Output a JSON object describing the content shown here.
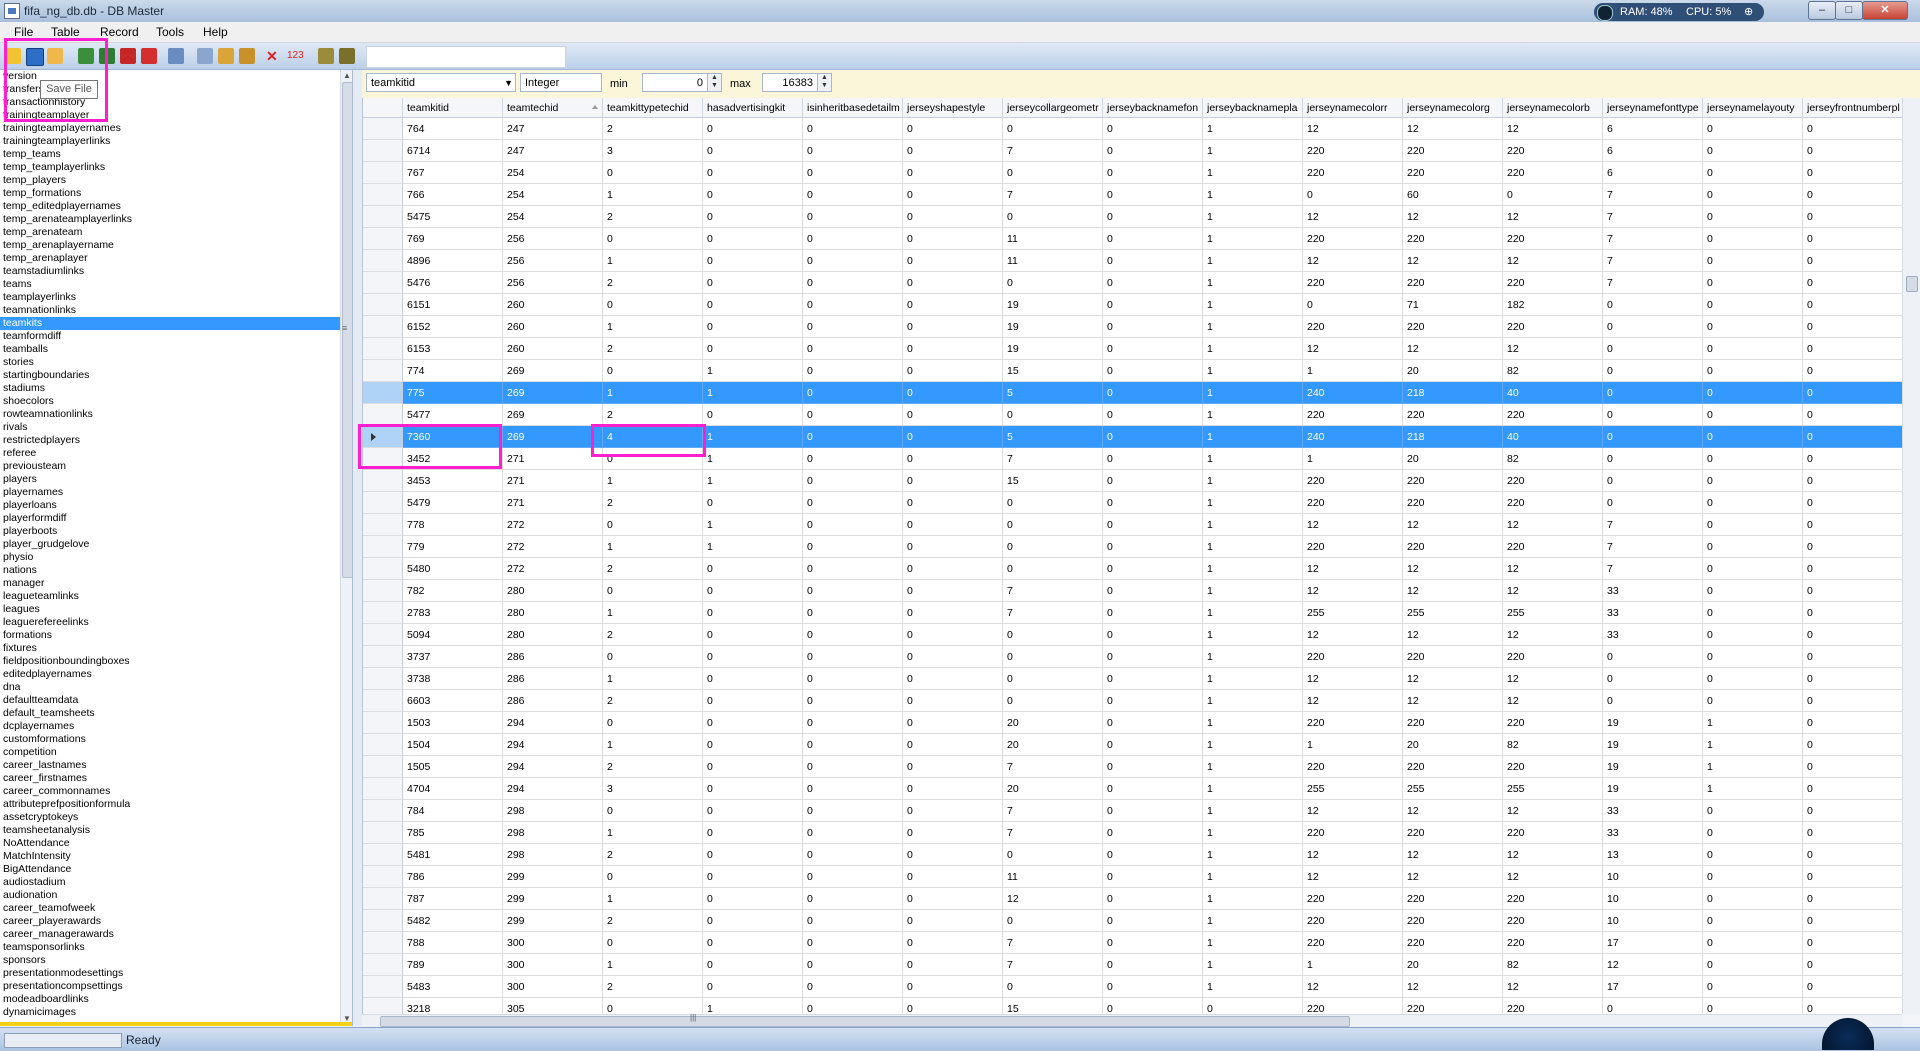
{
  "window": {
    "title": "fifa_ng_db.db - DB Master",
    "ram": "RAM: 48%",
    "cpu": "CPU: 5%",
    "controls": {
      "minimize": "–",
      "maximize": "□",
      "close": "✕"
    }
  },
  "menu": [
    "File",
    "Table",
    "Record",
    "Tools",
    "Help"
  ],
  "toolbar": {
    "buttons": [
      "open-icon",
      "save-icon",
      "folder-icon",
      "import-icon",
      "export-icon",
      "delete-table-icon",
      "export-red-icon",
      "compare-icon",
      "copy-icon",
      "paste-icon",
      "paste-special-icon",
      "delete-icon",
      "numbers-icon",
      "find-icon",
      "replace-icon"
    ],
    "tooltip": "Save File",
    "search_value": ""
  },
  "tables": [
    "version",
    "transfers",
    "transactionhistory",
    "trainingteamplayer",
    "trainingteamplayernames",
    "trainingteamplayerlinks",
    "temp_teams",
    "temp_teamplayerlinks",
    "temp_players",
    "temp_formations",
    "temp_editedplayernames",
    "temp_arenateamplayerlinks",
    "temp_arenateam",
    "temp_arenaplayername",
    "temp_arenaplayer",
    "teamstadiumlinks",
    "teams",
    "teamplayerlinks",
    "teamnationlinks",
    "teamkits",
    "teamformdiff",
    "teamballs",
    "stories",
    "startingboundaries",
    "stadiums",
    "shoecolors",
    "rowteamnationlinks",
    "rivals",
    "restrictedplayers",
    "referee",
    "previousteam",
    "players",
    "playernames",
    "playerloans",
    "playerformdiff",
    "playerboots",
    "player_grudgelove",
    "physio",
    "nations",
    "manager",
    "leagueteamlinks",
    "leagues",
    "leaguerefereelinks",
    "formations",
    "fixtures",
    "fieldpositionboundingboxes",
    "editedplayernames",
    "dna",
    "defaultteamdata",
    "default_teamsheets",
    "dcplayernames",
    "customformations",
    "competition",
    "career_lastnames",
    "career_firstnames",
    "career_commonnames",
    "attributeprefpositionformula",
    "assetcryptokeys",
    "teamsheetanalysis",
    "NoAttendance",
    "MatchIntensity",
    "BigAttendance",
    "audiostadium",
    "audionation",
    "career_teamofweek",
    "career_playerawards",
    "career_managerawards",
    "teamsponsorlinks",
    "sponsors",
    "presentationmodesettings",
    "presentationcompsettings",
    "modeadboardlinks",
    "dynamicimages"
  ],
  "selected_table": "teamkits",
  "filter": {
    "field": "teamkitid",
    "type": "Integer",
    "min_label": "min",
    "min_value": "0",
    "max_label": "max",
    "max_value": "16383"
  },
  "columns": [
    "teamkitid",
    "teamtechid",
    "teamkittypetechid",
    "hasadvertisingkit",
    "isinheritbasedetailm",
    "jerseyshapestyle",
    "jerseycollargeometr",
    "jerseybacknamefon",
    "jerseybacknamepla",
    "jerseynamecolorr",
    "jerseynamecolorg",
    "jerseynamecolorb",
    "jerseynamefonttype",
    "jerseynamelayouty",
    "jerseyfrontnumberpl"
  ],
  "rows": [
    [
      "764",
      "247",
      "2",
      "0",
      "0",
      "0",
      "0",
      "0",
      "1",
      "12",
      "12",
      "12",
      "6",
      "0",
      "0"
    ],
    [
      "6714",
      "247",
      "3",
      "0",
      "0",
      "0",
      "7",
      "0",
      "1",
      "220",
      "220",
      "220",
      "6",
      "0",
      "0"
    ],
    [
      "767",
      "254",
      "0",
      "0",
      "0",
      "0",
      "0",
      "0",
      "1",
      "220",
      "220",
      "220",
      "6",
      "0",
      "0"
    ],
    [
      "766",
      "254",
      "1",
      "0",
      "0",
      "0",
      "7",
      "0",
      "1",
      "0",
      "60",
      "0",
      "7",
      "0",
      "0"
    ],
    [
      "5475",
      "254",
      "2",
      "0",
      "0",
      "0",
      "0",
      "0",
      "1",
      "12",
      "12",
      "12",
      "7",
      "0",
      "0"
    ],
    [
      "769",
      "256",
      "0",
      "0",
      "0",
      "0",
      "11",
      "0",
      "1",
      "220",
      "220",
      "220",
      "7",
      "0",
      "0"
    ],
    [
      "4896",
      "256",
      "1",
      "0",
      "0",
      "0",
      "11",
      "0",
      "1",
      "12",
      "12",
      "12",
      "7",
      "0",
      "0"
    ],
    [
      "5476",
      "256",
      "2",
      "0",
      "0",
      "0",
      "0",
      "0",
      "1",
      "220",
      "220",
      "220",
      "7",
      "0",
      "0"
    ],
    [
      "6151",
      "260",
      "0",
      "0",
      "0",
      "0",
      "19",
      "0",
      "1",
      "0",
      "71",
      "182",
      "0",
      "0",
      "0"
    ],
    [
      "6152",
      "260",
      "1",
      "0",
      "0",
      "0",
      "19",
      "0",
      "1",
      "220",
      "220",
      "220",
      "0",
      "0",
      "0"
    ],
    [
      "6153",
      "260",
      "2",
      "0",
      "0",
      "0",
      "19",
      "0",
      "1",
      "12",
      "12",
      "12",
      "0",
      "0",
      "0"
    ],
    [
      "774",
      "269",
      "0",
      "1",
      "0",
      "0",
      "15",
      "0",
      "1",
      "1",
      "20",
      "82",
      "0",
      "0",
      "0"
    ],
    [
      "775",
      "269",
      "1",
      "1",
      "0",
      "0",
      "5",
      "0",
      "1",
      "240",
      "218",
      "40",
      "0",
      "0",
      "0"
    ],
    [
      "5477",
      "269",
      "2",
      "0",
      "0",
      "0",
      "0",
      "0",
      "1",
      "220",
      "220",
      "220",
      "0",
      "0",
      "0"
    ],
    [
      "7360",
      "269",
      "4",
      "1",
      "0",
      "0",
      "5",
      "0",
      "1",
      "240",
      "218",
      "40",
      "0",
      "0",
      "0"
    ],
    [
      "3452",
      "271",
      "0",
      "1",
      "0",
      "0",
      "7",
      "0",
      "1",
      "1",
      "20",
      "82",
      "0",
      "0",
      "0"
    ],
    [
      "3453",
      "271",
      "1",
      "1",
      "0",
      "0",
      "15",
      "0",
      "1",
      "220",
      "220",
      "220",
      "0",
      "0",
      "0"
    ],
    [
      "5479",
      "271",
      "2",
      "0",
      "0",
      "0",
      "0",
      "0",
      "1",
      "220",
      "220",
      "220",
      "0",
      "0",
      "0"
    ],
    [
      "778",
      "272",
      "0",
      "1",
      "0",
      "0",
      "0",
      "0",
      "1",
      "12",
      "12",
      "12",
      "7",
      "0",
      "0"
    ],
    [
      "779",
      "272",
      "1",
      "1",
      "0",
      "0",
      "0",
      "0",
      "1",
      "220",
      "220",
      "220",
      "7",
      "0",
      "0"
    ],
    [
      "5480",
      "272",
      "2",
      "0",
      "0",
      "0",
      "0",
      "0",
      "1",
      "12",
      "12",
      "12",
      "7",
      "0",
      "0"
    ],
    [
      "782",
      "280",
      "0",
      "0",
      "0",
      "0",
      "7",
      "0",
      "1",
      "12",
      "12",
      "12",
      "33",
      "0",
      "0"
    ],
    [
      "2783",
      "280",
      "1",
      "0",
      "0",
      "0",
      "7",
      "0",
      "1",
      "255",
      "255",
      "255",
      "33",
      "0",
      "0"
    ],
    [
      "5094",
      "280",
      "2",
      "0",
      "0",
      "0",
      "0",
      "0",
      "1",
      "12",
      "12",
      "12",
      "33",
      "0",
      "0"
    ],
    [
      "3737",
      "286",
      "0",
      "0",
      "0",
      "0",
      "0",
      "0",
      "1",
      "220",
      "220",
      "220",
      "0",
      "0",
      "0"
    ],
    [
      "3738",
      "286",
      "1",
      "0",
      "0",
      "0",
      "0",
      "0",
      "1",
      "12",
      "12",
      "12",
      "0",
      "0",
      "0"
    ],
    [
      "6603",
      "286",
      "2",
      "0",
      "0",
      "0",
      "0",
      "0",
      "1",
      "12",
      "12",
      "12",
      "0",
      "0",
      "0"
    ],
    [
      "1503",
      "294",
      "0",
      "0",
      "0",
      "0",
      "20",
      "0",
      "1",
      "220",
      "220",
      "220",
      "19",
      "1",
      "0"
    ],
    [
      "1504",
      "294",
      "1",
      "0",
      "0",
      "0",
      "20",
      "0",
      "1",
      "1",
      "20",
      "82",
      "19",
      "1",
      "0"
    ],
    [
      "1505",
      "294",
      "2",
      "0",
      "0",
      "0",
      "7",
      "0",
      "1",
      "220",
      "220",
      "220",
      "19",
      "1",
      "0"
    ],
    [
      "4704",
      "294",
      "3",
      "0",
      "0",
      "0",
      "20",
      "0",
      "1",
      "255",
      "255",
      "255",
      "19",
      "1",
      "0"
    ],
    [
      "784",
      "298",
      "0",
      "0",
      "0",
      "0",
      "7",
      "0",
      "1",
      "12",
      "12",
      "12",
      "33",
      "0",
      "0"
    ],
    [
      "785",
      "298",
      "1",
      "0",
      "0",
      "0",
      "7",
      "0",
      "1",
      "220",
      "220",
      "220",
      "33",
      "0",
      "0"
    ],
    [
      "5481",
      "298",
      "2",
      "0",
      "0",
      "0",
      "0",
      "0",
      "1",
      "12",
      "12",
      "12",
      "13",
      "0",
      "0"
    ],
    [
      "786",
      "299",
      "0",
      "0",
      "0",
      "0",
      "11",
      "0",
      "1",
      "12",
      "12",
      "12",
      "10",
      "0",
      "0"
    ],
    [
      "787",
      "299",
      "1",
      "0",
      "0",
      "0",
      "12",
      "0",
      "1",
      "220",
      "220",
      "220",
      "10",
      "0",
      "0"
    ],
    [
      "5482",
      "299",
      "2",
      "0",
      "0",
      "0",
      "0",
      "0",
      "1",
      "220",
      "220",
      "220",
      "10",
      "0",
      "0"
    ],
    [
      "788",
      "300",
      "0",
      "0",
      "0",
      "0",
      "7",
      "0",
      "1",
      "220",
      "220",
      "220",
      "17",
      "0",
      "0"
    ],
    [
      "789",
      "300",
      "1",
      "0",
      "0",
      "0",
      "7",
      "0",
      "1",
      "1",
      "20",
      "82",
      "12",
      "0",
      "0"
    ],
    [
      "5483",
      "300",
      "2",
      "0",
      "0",
      "0",
      "0",
      "0",
      "1",
      "12",
      "12",
      "12",
      "17",
      "0",
      "0"
    ],
    [
      "3218",
      "305",
      "0",
      "1",
      "0",
      "0",
      "15",
      "0",
      "0",
      "220",
      "220",
      "220",
      "0",
      "0",
      "0"
    ]
  ],
  "selected_rows": [
    12,
    14
  ],
  "current_row": 14,
  "status": {
    "text": "Ready"
  },
  "colors": {
    "selection": "#3399ff",
    "highlight": "#ff1fcf",
    "filter_bg": "#fbf6d9"
  }
}
